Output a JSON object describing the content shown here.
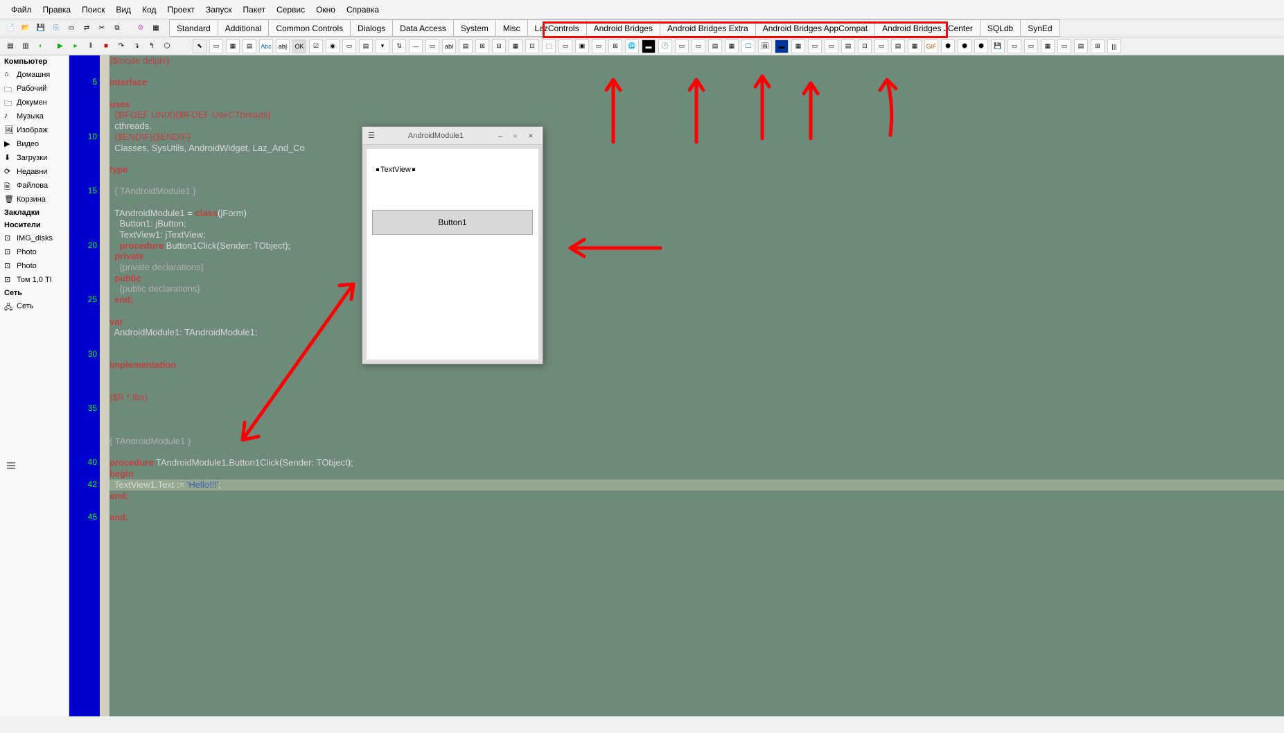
{
  "menu": {
    "items": [
      "Файл",
      "Правка",
      "Поиск",
      "Вид",
      "Код",
      "Проект",
      "Запуск",
      "Пакет",
      "Сервис",
      "Окно",
      "Справка"
    ]
  },
  "palette_tabs": [
    "Standard",
    "Additional",
    "Common Controls",
    "Dialogs",
    "Data Access",
    "System",
    "Misc",
    "LazControls",
    "Android Bridges",
    "Android Bridges Extra",
    "Android Bridges AppCompat",
    "Android Bridges JCenter",
    "SQLdb",
    "SynEd"
  ],
  "sidebar": {
    "header_top": "Компьютер",
    "items_top": [
      {
        "icon": "home",
        "label": "Домашня"
      },
      {
        "icon": "folder",
        "label": "Рабочий"
      },
      {
        "icon": "folder",
        "label": "Докумен"
      },
      {
        "icon": "music",
        "label": "Музыка"
      },
      {
        "icon": "image",
        "label": "Изображ"
      },
      {
        "icon": "video",
        "label": "Видео"
      },
      {
        "icon": "download",
        "label": "Загрузки"
      },
      {
        "icon": "recent",
        "label": "Недавни"
      },
      {
        "icon": "filesystem",
        "label": "Файлова"
      },
      {
        "icon": "trash",
        "label": "Корзина"
      }
    ],
    "header_bookmarks": "Закладки",
    "header_media": "Носители",
    "items_media": [
      {
        "icon": "disk",
        "label": "IMG_disks"
      },
      {
        "icon": "disk",
        "label": "Photo"
      },
      {
        "icon": "disk",
        "label": "Photo"
      },
      {
        "icon": "disk",
        "label": "Том 1,0 ТI"
      }
    ],
    "header_net": "Сеть",
    "items_net": [
      {
        "icon": "net",
        "label": "Сеть"
      }
    ]
  },
  "designer": {
    "title": "AndroidModule1",
    "textview_label": "TextView",
    "button_label": "Button1"
  },
  "code": {
    "lines": [
      {
        "n": "",
        "t": "{$mode delphi}",
        "cls": "dir"
      },
      {
        "n": "",
        "t": ""
      },
      {
        "n": "5",
        "t": "interface",
        "cls": "kw"
      },
      {
        "n": "",
        "t": ""
      },
      {
        "n": "",
        "t": "uses",
        "cls": "kw"
      },
      {
        "n": "",
        "t": "  {$IFDEF UNIX}{$IFDEF UseCThreads}",
        "cls": "dir"
      },
      {
        "n": "",
        "t": "  cthreads,",
        "cls": "id"
      },
      {
        "n": "10",
        "t": "  {$ENDIF}{$ENDIF}",
        "cls": "dir"
      },
      {
        "n": "",
        "t": "  Classes, SysUtils, AndroidWidget, Laz_And_Co",
        "cls": "id"
      },
      {
        "n": "",
        "t": ""
      },
      {
        "n": "",
        "t": "type",
        "cls": "kw"
      },
      {
        "n": "",
        "t": ""
      },
      {
        "n": "15",
        "t": "  { TAndroidModule1 }",
        "cls": "cmt"
      },
      {
        "n": "",
        "t": ""
      },
      {
        "n": "",
        "t": "  TAndroidModule1 = class(jForm)",
        "cls": "mix-class"
      },
      {
        "n": "",
        "t": "    Button1: jButton;",
        "cls": "id"
      },
      {
        "n": "",
        "t": "    TextView1: jTextView;",
        "cls": "id"
      },
      {
        "n": "20",
        "t": "    procedure Button1Click(Sender: TObject);",
        "cls": "mix-proc"
      },
      {
        "n": "",
        "t": "  private",
        "cls": "kw"
      },
      {
        "n": "",
        "t": "    {private declarations}",
        "cls": "cmt"
      },
      {
        "n": "",
        "t": "  public",
        "cls": "kw"
      },
      {
        "n": "",
        "t": "    {public declarations}",
        "cls": "cmt"
      },
      {
        "n": "25",
        "t": "  end;",
        "cls": "kw"
      },
      {
        "n": "",
        "t": ""
      },
      {
        "n": "",
        "t": "var",
        "cls": "kw"
      },
      {
        "n": "",
        "t": "  AndroidModule1: TAndroidModule1;",
        "cls": "id"
      },
      {
        "n": "",
        "t": ""
      },
      {
        "n": "30",
        "t": ""
      },
      {
        "n": "",
        "t": "implementation",
        "cls": "kw"
      },
      {
        "n": "",
        "t": ""
      },
      {
        "n": "",
        "t": ""
      },
      {
        "n": "",
        "t": "{$R *.lfm}",
        "cls": "dir"
      },
      {
        "n": "35",
        "t": ""
      },
      {
        "n": "",
        "t": ""
      },
      {
        "n": "",
        "t": ""
      },
      {
        "n": "",
        "t": "{ TAndroidModule1 }",
        "cls": "cmt"
      },
      {
        "n": "",
        "t": ""
      },
      {
        "n": "40",
        "t": "procedure TAndroidModule1.Button1Click(Sender: TObject);",
        "cls": "mix-proc2"
      },
      {
        "n": "",
        "t": "begin",
        "cls": "kw"
      },
      {
        "n": "42",
        "t": "  TextView1.Text := 'Hello!!!';",
        "cls": "mix-str",
        "cur": true
      },
      {
        "n": "",
        "t": "end;",
        "cls": "kw"
      },
      {
        "n": "",
        "t": ""
      },
      {
        "n": "45",
        "t": "end.",
        "cls": "kw"
      }
    ]
  }
}
